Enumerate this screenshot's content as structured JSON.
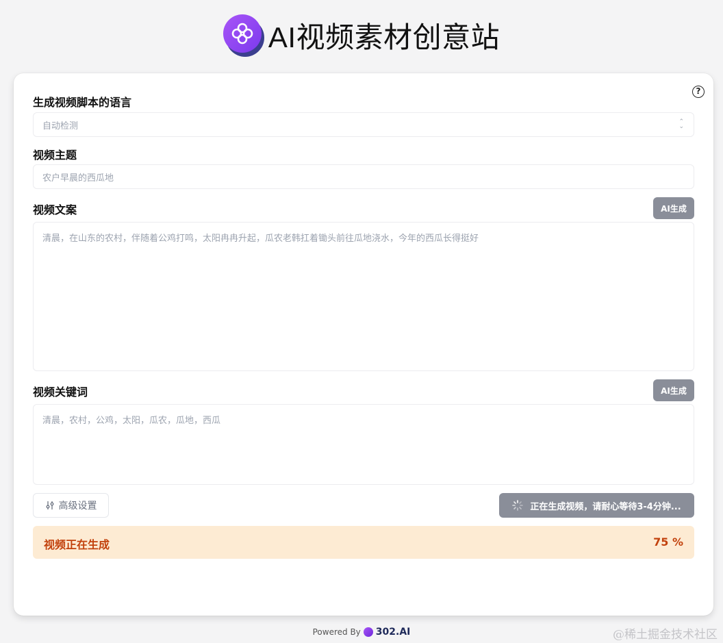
{
  "app": {
    "title": "AI视频素材创意站"
  },
  "help": {
    "icon": "help-circle-icon",
    "symbol": "?"
  },
  "language": {
    "label": "生成视频脚本的语言",
    "selected": "自动检测"
  },
  "topic": {
    "label": "视频主题",
    "placeholder": "农户早晨的西瓜地"
  },
  "script": {
    "label": "视频文案",
    "ai_button": "AI生成",
    "placeholder": "清晨，在山东的农村，伴随着公鸡打鸣，太阳冉冉升起，瓜农老韩扛着锄头前往瓜地浇水，今年的西瓜长得挺好"
  },
  "keywords": {
    "label": "视频关键词",
    "ai_button": "AI生成",
    "placeholder": "清晨，农村，公鸡，太阳，瓜农，瓜地，西瓜"
  },
  "actions": {
    "advanced": "高级设置",
    "generate_status": "正在生成视频，请耐心等待3-4分钟..."
  },
  "progress": {
    "label": "视频正在生成",
    "value": 75,
    "display": "75 %"
  },
  "footer": {
    "powered_by": "Powered By",
    "brand": "302.AI"
  },
  "watermark": "@稀土掘金技术社区",
  "colors": {
    "accent": "#7c3aed",
    "button_gray": "#8a8e99",
    "progress_bg": "#fdebd3",
    "progress_text": "#c2410c"
  }
}
